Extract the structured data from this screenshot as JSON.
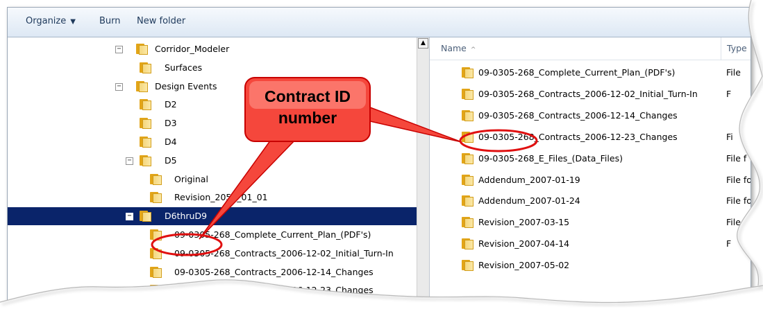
{
  "toolbar": {
    "organize_label": "Organize",
    "burn_label": "Burn",
    "new_folder_label": "New folder"
  },
  "tree": {
    "items": [
      {
        "label": "Corridor_Modeler",
        "expander": "−"
      },
      {
        "label": "Surfaces",
        "expander": ""
      },
      {
        "label": "Design Events",
        "expander": "−"
      },
      {
        "label": "D2",
        "expander": ""
      },
      {
        "label": "D3",
        "expander": ""
      },
      {
        "label": "D4",
        "expander": ""
      },
      {
        "label": "D5",
        "expander": "−"
      },
      {
        "label": "Original",
        "expander": ""
      },
      {
        "label": "Revision_2050_01_01",
        "expander": ""
      },
      {
        "label": "D6thruD9",
        "expander": "−",
        "selected": true
      },
      {
        "label": "09-0305-268_Complete_Current_Plan_(PDF's)",
        "expander": ""
      },
      {
        "label": "09-0305-268_Contracts_2006-12-02_Initial_Turn-In",
        "expander": ""
      },
      {
        "label": "09-0305-268_Contracts_2006-12-14_Changes",
        "expander": ""
      },
      {
        "label": "09-0305-268_Contracts_2006-12-23_Changes",
        "expander": ""
      }
    ]
  },
  "list": {
    "header": {
      "name": "Name",
      "type": "Type"
    },
    "rows": [
      {
        "name": "09-0305-268_Complete_Current_Plan_(PDF's)",
        "type": "File"
      },
      {
        "name": "09-0305-268_Contracts_2006-12-02_Initial_Turn-In",
        "type": "F"
      },
      {
        "name": "09-0305-268_Contracts_2006-12-14_Changes",
        "type": ""
      },
      {
        "name": "09-0305-268_Contracts_2006-12-23_Changes",
        "type": "Fi"
      },
      {
        "name": "09-0305-268_E_Files_(Data_Files)",
        "type": "File f"
      },
      {
        "name": "Addendum_2007-01-19",
        "type": "File fol"
      },
      {
        "name": "Addendum_2007-01-24",
        "type": "File fol"
      },
      {
        "name": "Revision_2007-03-15",
        "type": "File"
      },
      {
        "name": "Revision_2007-04-14",
        "type": "F"
      },
      {
        "name": "Revision_2007-05-02",
        "type": ""
      }
    ]
  },
  "callout": {
    "line1": "Contract ID",
    "line2": "number",
    "fill_color": "#f5473c",
    "ring_color": "#e01010"
  },
  "colors": {
    "selection": "#0a246a",
    "folder": "#e2a518",
    "toolbar_text": "#1e395b"
  }
}
